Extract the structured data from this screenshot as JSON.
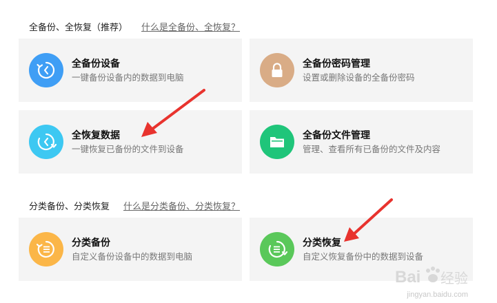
{
  "full_section": {
    "title": "全备份、全恢复（推荐）",
    "link": "什么是全备份、全恢复？"
  },
  "category_section": {
    "title": "分类备份、分类恢复",
    "link": "什么是分类备份、分类恢复？"
  },
  "cards": {
    "full_backup": {
      "name": "全备份设备",
      "desc": "一键备份设备内的数据到电脑",
      "icon": "backup-clock-icon",
      "color": "#3f9ef5"
    },
    "password": {
      "name": "全备份密码管理",
      "desc": "设置或删除设备的全备份密码",
      "icon": "lock-icon",
      "color": "#d9ac86"
    },
    "full_restore": {
      "name": "全恢复数据",
      "desc": "一键恢复已备份的文件到设备",
      "icon": "restore-cycle-icon",
      "color": "#3dc8f2"
    },
    "file_manage": {
      "name": "全备份文件管理",
      "desc": "管理、查看所有已备份的文件及内容",
      "icon": "folder-icon",
      "color": "#1fc57a"
    },
    "cat_backup": {
      "name": "分类备份",
      "desc": "自定义备份设备中的数据到电脑",
      "icon": "category-backup-icon",
      "color": "#fbb648"
    },
    "cat_restore": {
      "name": "分类恢复",
      "desc": "自定义恢复备份中的数据到设备",
      "icon": "category-restore-icon",
      "color": "#5ac85a"
    }
  },
  "watermark": {
    "text": "jingyan.baidu.com",
    "logo_text": "Bai 经验",
    "arrow_color": "#e8332e"
  }
}
